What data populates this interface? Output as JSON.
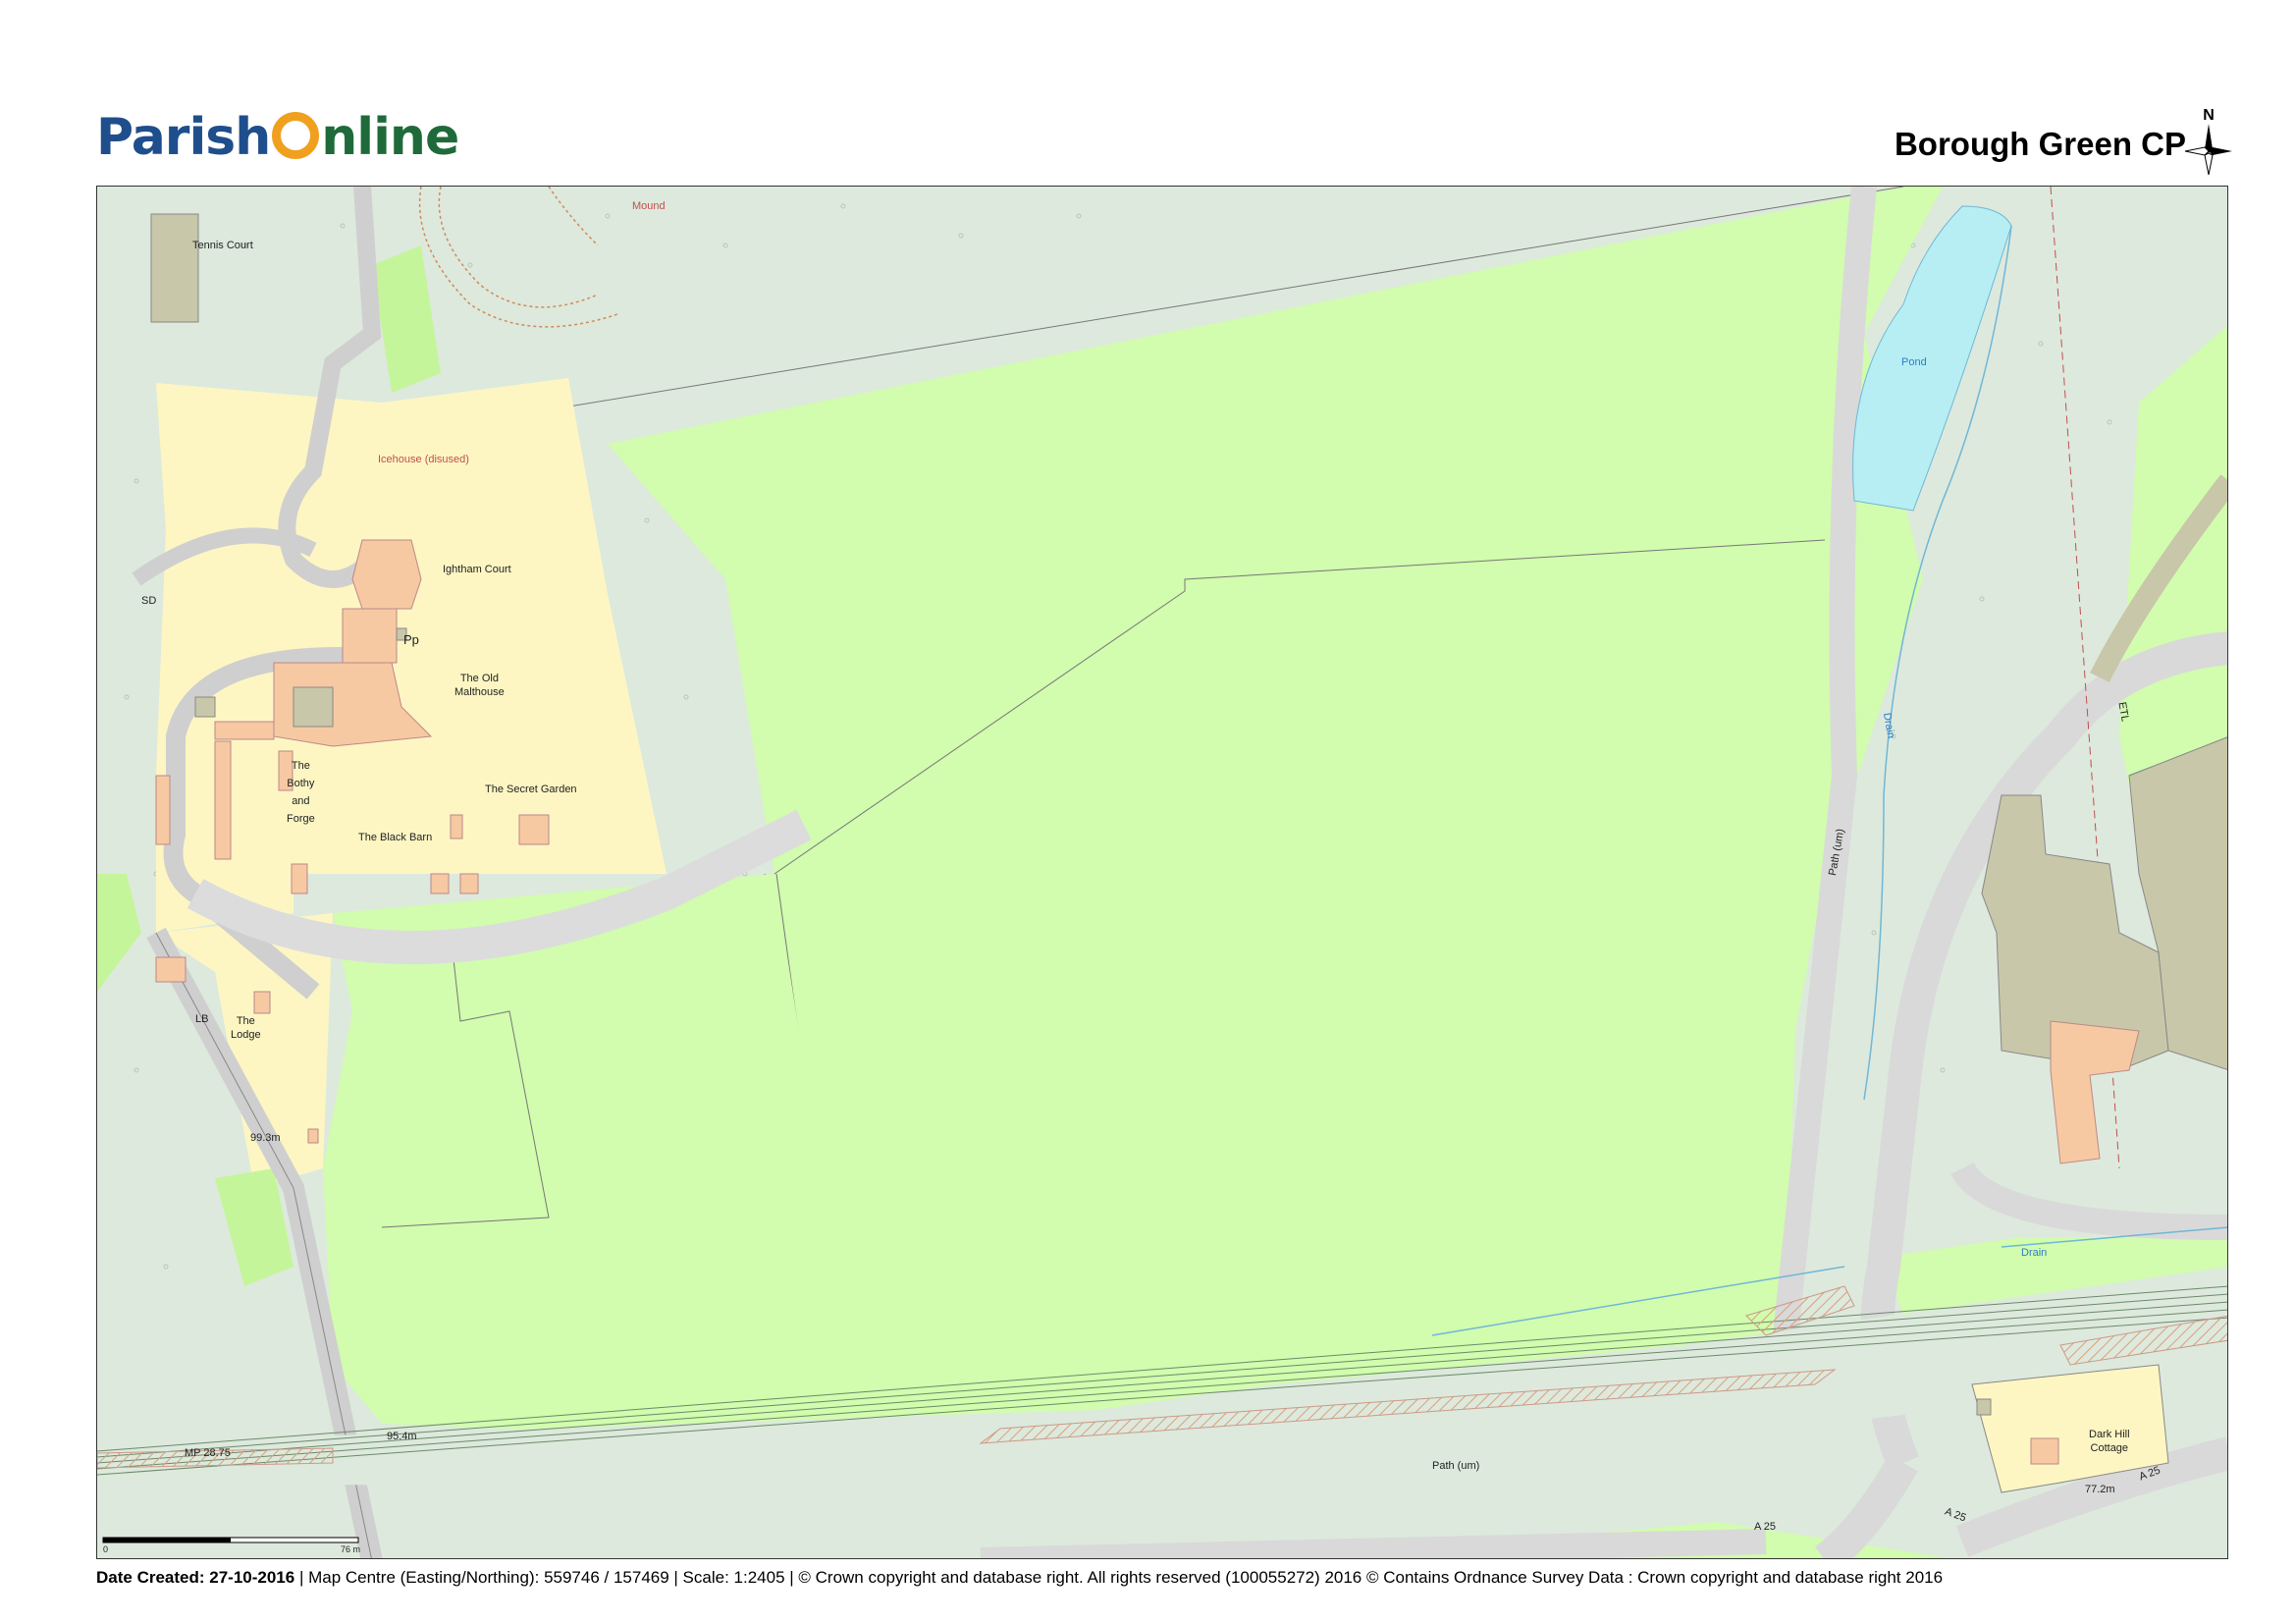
{
  "header": {
    "logo": {
      "part1": "Parish",
      "part2": "nline"
    },
    "title": "Borough Green CP",
    "north_label": "N"
  },
  "map": {
    "labels": {
      "mound": "Mound",
      "tennis_court": "Tennis Court",
      "icehouse": "Icehouse (disused)",
      "ightham_court": "Ightham Court",
      "sd": "SD",
      "pp": "Pp",
      "old_malthouse_1": "The Old",
      "old_malthouse_2": "Malthouse",
      "bothy_1": "The",
      "bothy_2": "Bothy",
      "bothy_3": "and",
      "bothy_4": "Forge",
      "secret_garden": "The Secret Garden",
      "black_barn": "The Black Barn",
      "lb": "LB",
      "lodge_1": "The",
      "lodge_2": "Lodge",
      "spot_993": "99.3m",
      "spot_954": "95.4m",
      "mp": "MP 28.75",
      "path_um_bottom": "Path (um)",
      "path_um_right": "Path (um)",
      "pond": "Pond",
      "drain_vertical": "Drain",
      "drain_bottom": "Drain",
      "etl": "ETL",
      "dark_hill_1": "Dark Hill",
      "dark_hill_2": "Cottage",
      "spot_772": "77.2m",
      "a25_right": "A 25",
      "a25_bottom": "A 25",
      "a25_mid": "A 25",
      "scale_zero": "0",
      "scale_end": "76 m"
    }
  },
  "footer": {
    "date_label": "Date Created: 27-10-2016",
    "details": " | Map Centre (Easting/Northing): 559746 / 157469 | Scale: 1:2405 | © Crown copyright and database right. All rights reserved (100055272) 2016 © Contains Ordnance Survey Data : Crown copyright and database right 2016"
  },
  "colors": {
    "field": "#d2fcae",
    "woodland": "#dde9dd",
    "garden": "#fdf6c3",
    "building": "#f7c9a3",
    "grey_building": "#c8c7a9",
    "road": "#d9d9d9",
    "water": "#b7eef4",
    "grass": "#c5f59b"
  }
}
